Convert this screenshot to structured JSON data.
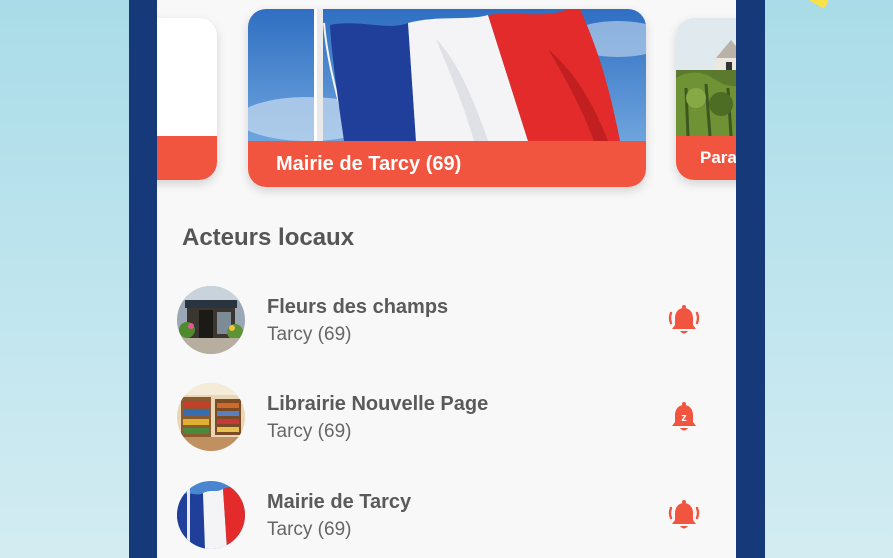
{
  "carousel": {
    "left_card": {
      "label": ""
    },
    "main_card": {
      "label": "Mairie de Tarcy (69)",
      "image": "french-flag-photo"
    },
    "right_card": {
      "label": "Para",
      "image": "vineyard-house-photo"
    }
  },
  "section": {
    "title": "Acteurs locaux"
  },
  "actors": [
    {
      "name": "Fleurs des champs",
      "location": "Tarcy (69)",
      "avatar": "flower-shop-photo",
      "bell": "bell-ringing-icon"
    },
    {
      "name": "Librairie Nouvelle Page",
      "location": "Tarcy (69)",
      "avatar": "bookstore-photo",
      "bell": "bell-snooze-icon",
      "bell_badge": "z"
    },
    {
      "name": "Mairie de Tarcy",
      "location": "Tarcy (69)",
      "avatar": "french-flag-photo",
      "bell": "bell-ringing-icon"
    }
  ],
  "colors": {
    "accent": "#f2553f",
    "frame": "#16397a",
    "screen_bg": "#f8f8f8",
    "text_dark": "#555555",
    "background": "#a9dce8"
  }
}
